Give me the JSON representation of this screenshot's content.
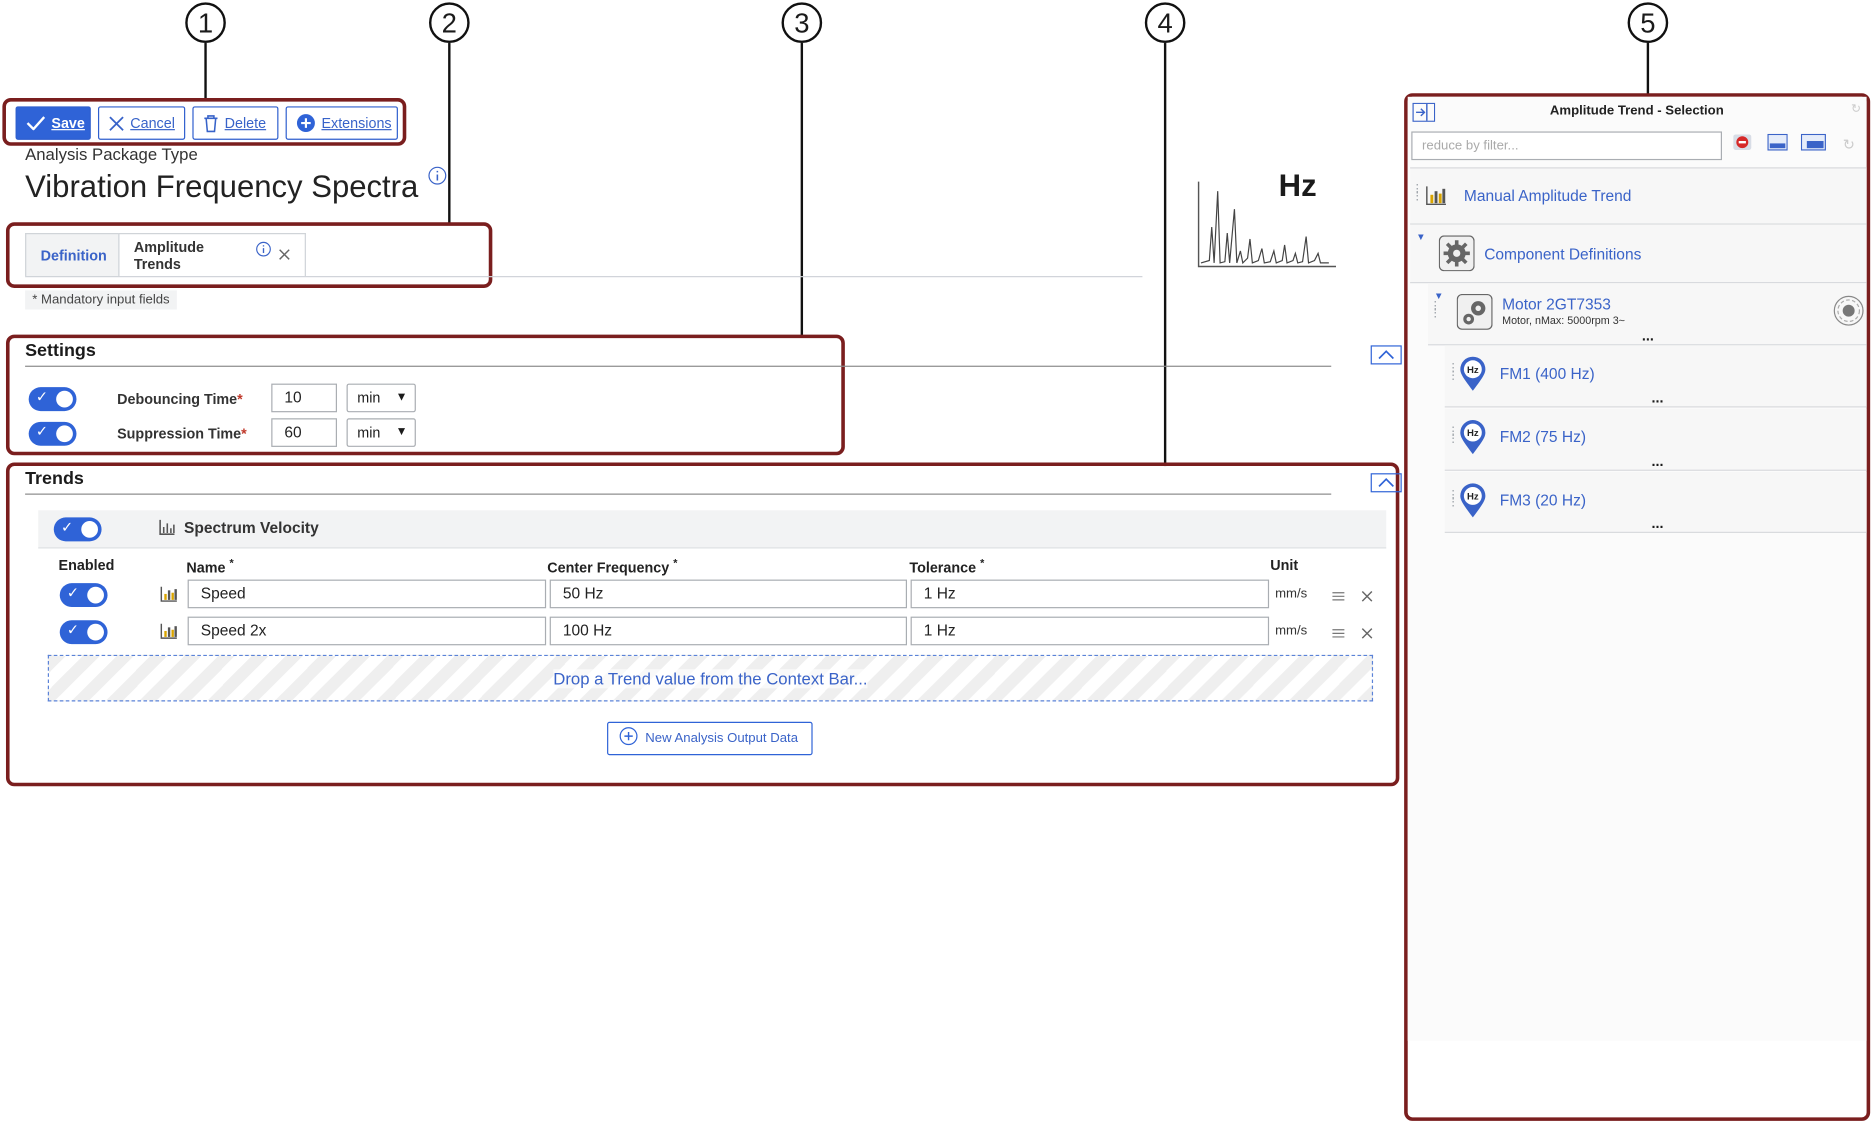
{
  "callouts": [
    "1",
    "2",
    "3",
    "4",
    "5"
  ],
  "toolbar": {
    "save_label": "Save",
    "cancel_label": "Cancel",
    "delete_label": "Delete",
    "extensions_label": "Extensions"
  },
  "header": {
    "type_label": "Analysis Package Type",
    "title": "Vibration Frequency Spectra",
    "preview_unit": "Hz"
  },
  "tabs": [
    {
      "label": "Definition",
      "active": true
    },
    {
      "label": "Amplitude Trends",
      "active": false
    }
  ],
  "mandatory_note": "* Mandatory input fields",
  "settings": {
    "title": "Settings",
    "rows": [
      {
        "label": "Debouncing Time",
        "required": "*",
        "value": "10",
        "unit": "min",
        "enabled": true
      },
      {
        "label": "Suppression Time",
        "required": "*",
        "value": "60",
        "unit": "min",
        "enabled": true
      }
    ]
  },
  "trends": {
    "title": "Trends",
    "group_label": "Spectrum Velocity",
    "columns": {
      "enabled": "Enabled",
      "name": "Name",
      "center_frequency": "Center Frequency",
      "tolerance": "Tolerance",
      "unit": "Unit",
      "required": "*"
    },
    "rows": [
      {
        "enabled": true,
        "name": "Speed",
        "center_frequency": "50 Hz",
        "tolerance": "1 Hz",
        "unit": "mm/s"
      },
      {
        "enabled": true,
        "name": "Speed 2x",
        "center_frequency": "100 Hz",
        "tolerance": "1 Hz",
        "unit": "mm/s"
      }
    ],
    "drop_zone_text": "Drop a Trend value from the Context Bar...",
    "new_output_label": "New Analysis Output Data"
  },
  "context_panel": {
    "title": "Amplitude Trend - Selection",
    "filter_placeholder": "reduce by filter...",
    "items": [
      {
        "label": "Manual Amplitude Trend",
        "icon": "bar-chart-icon"
      },
      {
        "label": "Component Definitions",
        "icon": "gear-icon"
      },
      {
        "label": "Motor 2GT7353",
        "sublabel": "Motor, nMax: 5000rpm 3~",
        "icon": "gears-icon"
      },
      {
        "label": "FM1 (400 Hz)",
        "icon": "hz-pin-icon"
      },
      {
        "label": "FM2 (75 Hz)",
        "icon": "hz-pin-icon"
      },
      {
        "label": "FM3 (20 Hz)",
        "icon": "hz-pin-icon"
      }
    ],
    "ellipsis": "..."
  },
  "colors": {
    "accent": "#2f63d7",
    "callout_box": "#7a1e1e",
    "link": "#3a63c8"
  }
}
